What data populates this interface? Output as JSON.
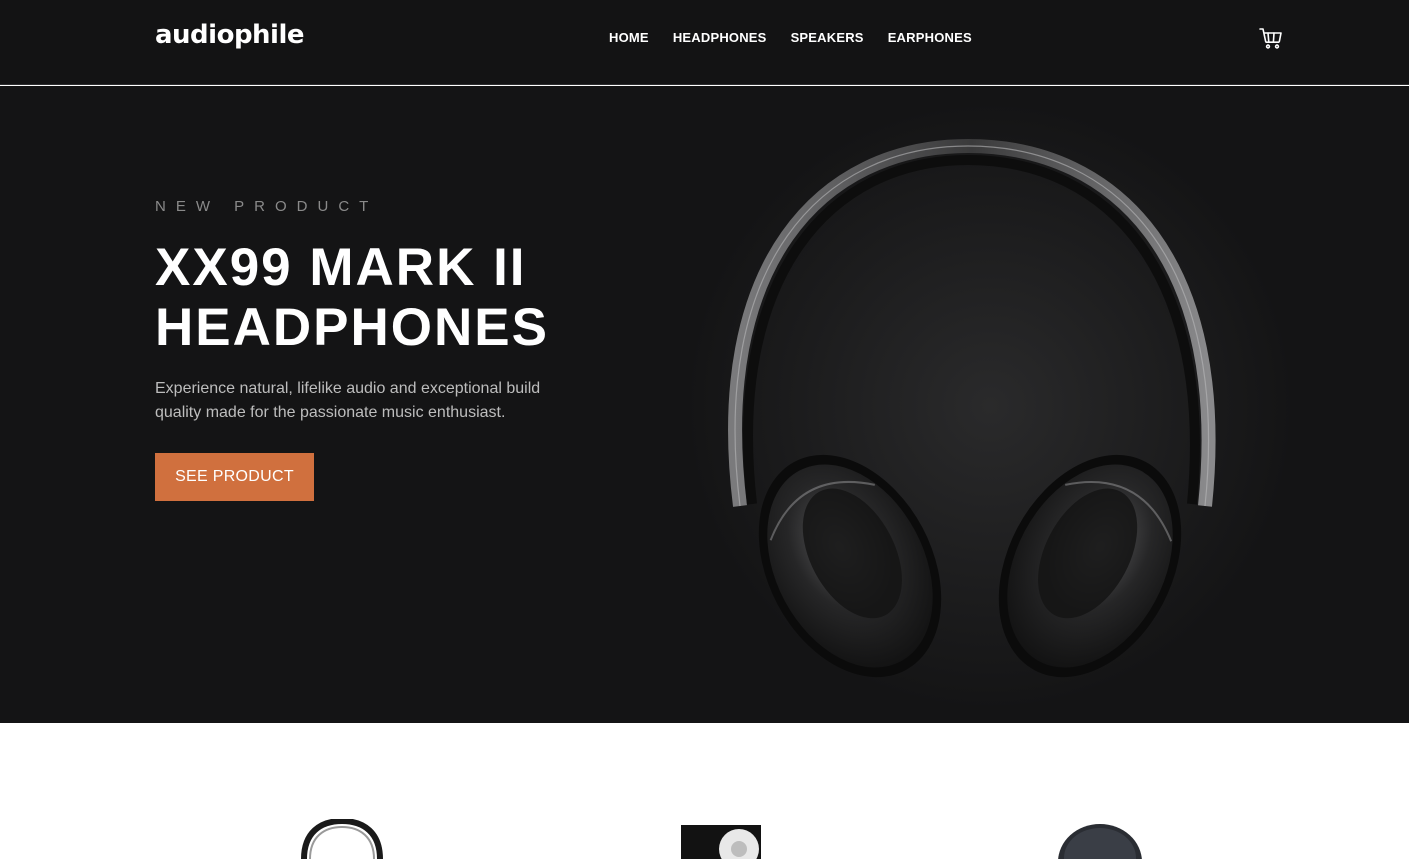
{
  "header": {
    "logo": "audiophile",
    "nav": [
      {
        "label": "HOME"
      },
      {
        "label": "HEADPHONES"
      },
      {
        "label": "SPEAKERS"
      },
      {
        "label": "EARPHONES"
      }
    ],
    "cart_icon": "cart-icon"
  },
  "hero": {
    "overline": "NEW PRODUCT",
    "title_line1": "XX99 MARK II",
    "title_line2": "HEADPHONES",
    "description": "Experience natural, lifelike audio and exceptional build quality made for the passionate music enthusiast.",
    "cta_label": "SEE PRODUCT",
    "image": "headphones-image"
  },
  "categories": {
    "items": [
      {
        "image": "headphones-thumbnail"
      },
      {
        "image": "speaker-thumbnail"
      },
      {
        "image": "earphones-thumbnail"
      }
    ]
  },
  "colors": {
    "header_bg": "#131314",
    "hero_bg": "#141415",
    "accent": "#d0703e",
    "text_muted": "#bdbdbd"
  }
}
